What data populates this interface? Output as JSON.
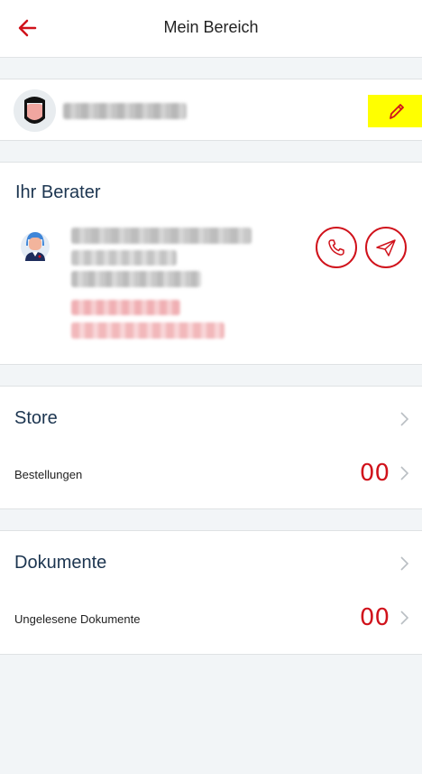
{
  "header": {
    "title": "Mein Bereich",
    "back_icon": "arrow-left-icon",
    "accent_color": "#d0121b"
  },
  "profile": {
    "avatar_icon": "user-avatar-icon",
    "edit_icon": "pencil-icon",
    "edit_highlight": "#ffff00"
  },
  "berater": {
    "title": "Ihr Berater",
    "avatar_icon": "advisor-avatar-icon",
    "call_icon": "phone-icon",
    "mail_icon": "send-icon"
  },
  "store": {
    "title": "Store",
    "orders_label": "Bestellungen",
    "orders_count": "00",
    "chevron_icon": "chevron-right-icon"
  },
  "dokumente": {
    "title": "Dokumente",
    "unread_label": "Ungelesene Dokumente",
    "unread_count": "00",
    "chevron_icon": "chevron-right-icon"
  }
}
